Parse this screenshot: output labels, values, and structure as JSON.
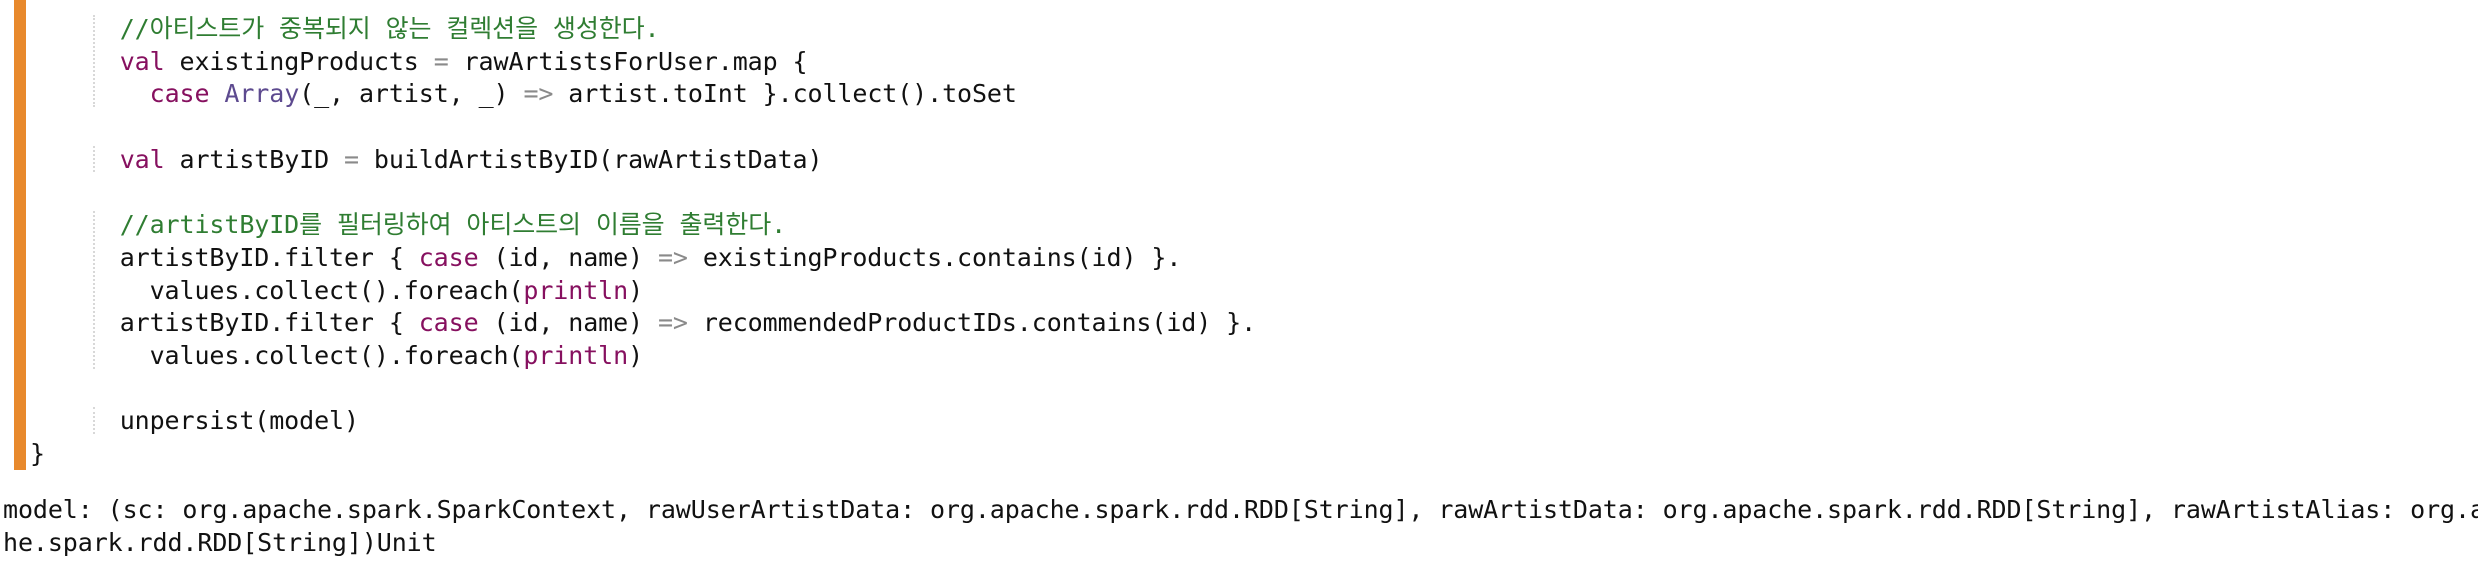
{
  "theme": {
    "accent_bar": "#e8892c",
    "comment": "#2f7d32",
    "keyword": "#86105f"
  },
  "code_cell": {
    "lines": [
      [
        {
          "t": "      //아티스트가 중복되지 않는 컬렉션을 생성한다.",
          "c": "cm"
        }
      ],
      [
        {
          "t": "      ",
          "c": "pl"
        },
        {
          "t": "val",
          "c": "kw"
        },
        {
          "t": " existingProducts ",
          "c": "pl"
        },
        {
          "t": "=",
          "c": "op"
        },
        {
          "t": " rawArtistsForUser.map {",
          "c": "pl"
        }
      ],
      [
        {
          "t": "        ",
          "c": "pl"
        },
        {
          "t": "case",
          "c": "kw"
        },
        {
          "t": " ",
          "c": "pl"
        },
        {
          "t": "Array",
          "c": "ty"
        },
        {
          "t": "(_, artist, _) ",
          "c": "pl"
        },
        {
          "t": "=>",
          "c": "op"
        },
        {
          "t": " artist.toInt }.collect().toSet",
          "c": "pl"
        }
      ],
      [],
      [
        {
          "t": "      ",
          "c": "pl"
        },
        {
          "t": "val",
          "c": "kw"
        },
        {
          "t": " artistByID ",
          "c": "pl"
        },
        {
          "t": "=",
          "c": "op"
        },
        {
          "t": " buildArtistByID(rawArtistData)",
          "c": "pl"
        }
      ],
      [],
      [
        {
          "t": "      //artistByID를 필터링하여 아티스트의 이름을 출력한다.",
          "c": "cm"
        }
      ],
      [
        {
          "t": "      artistByID.filter { ",
          "c": "pl"
        },
        {
          "t": "case",
          "c": "kw"
        },
        {
          "t": " (id, name) ",
          "c": "pl"
        },
        {
          "t": "=>",
          "c": "op"
        },
        {
          "t": " existingProducts.contains(id) }.",
          "c": "pl"
        }
      ],
      [
        {
          "t": "        values.collect().foreach(",
          "c": "pl"
        },
        {
          "t": "println",
          "c": "fn"
        },
        {
          "t": ")",
          "c": "pl"
        }
      ],
      [
        {
          "t": "      artistByID.filter { ",
          "c": "pl"
        },
        {
          "t": "case",
          "c": "kw"
        },
        {
          "t": " (id, name) ",
          "c": "pl"
        },
        {
          "t": "=>",
          "c": "op"
        },
        {
          "t": " recommendedProductIDs.contains(id) }.",
          "c": "pl"
        }
      ],
      [
        {
          "t": "        values.collect().foreach(",
          "c": "pl"
        },
        {
          "t": "println",
          "c": "fn"
        },
        {
          "t": ")",
          "c": "pl"
        }
      ],
      [],
      [
        {
          "t": "      unpersist(model)",
          "c": "pl"
        }
      ],
      [
        {
          "t": "}",
          "c": "pl"
        }
      ]
    ]
  },
  "output": {
    "lines": [
      "model: (sc: org.apache.spark.SparkContext, rawUserArtistData: org.apache.spark.rdd.RDD[String], rawArtistData: org.apache.spark.rdd.RDD[String], rawArtistAlias: org.apac",
      "he.spark.rdd.RDD[String])Unit"
    ]
  }
}
